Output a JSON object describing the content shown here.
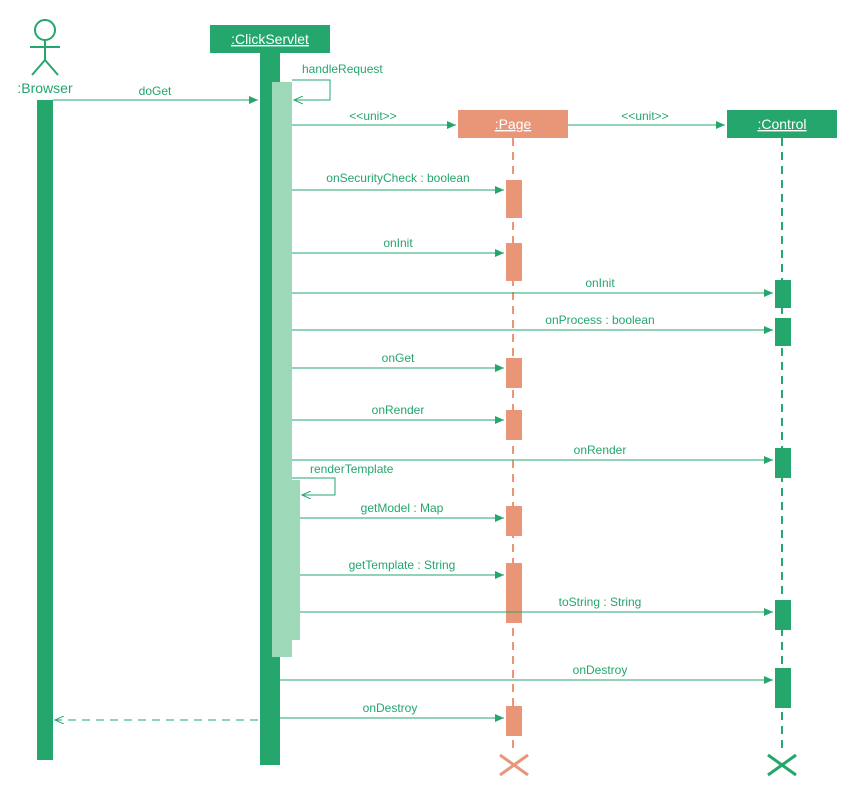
{
  "actors": {
    "browser": ":Browser",
    "clickServlet": ":ClickServlet",
    "page": ":Page",
    "control": ":Control"
  },
  "messages": {
    "doGet": "doGet",
    "handleRequest": "handleRequest",
    "unit1": "<<unit>>",
    "unit2": "<<unit>>",
    "onSecurityCheck": "onSecurityCheck : boolean",
    "onInit1": "onInit",
    "onInit2": "onInit",
    "onProcess": "onProcess : boolean",
    "onGet": "onGet",
    "onRender1": "onRender",
    "onRender2": "onRender",
    "renderTemplate": "renderTemplate",
    "getModel": "getModel : Map",
    "getTemplate": "getTemplate : String",
    "toString": "toString : String",
    "onDestroy1": "onDestroy",
    "onDestroy2": "onDestroy"
  }
}
